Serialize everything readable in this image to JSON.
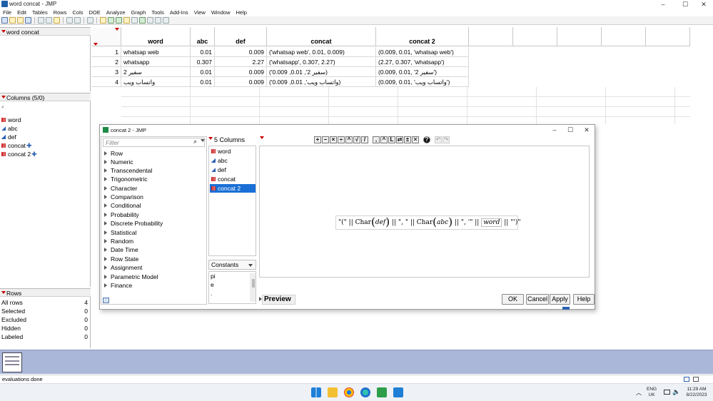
{
  "window": {
    "title": "word concat - JMP",
    "min": "–",
    "max": "☐",
    "close": "✕"
  },
  "menu": [
    "File",
    "Edit",
    "Tables",
    "Rows",
    "Cols",
    "DOE",
    "Analyze",
    "Graph",
    "Tools",
    "Add-Ins",
    "View",
    "Window",
    "Help"
  ],
  "table_panel": {
    "title": "word concat"
  },
  "columns_panel": {
    "title": "Columns (5/0)",
    "items": [
      {
        "label": "word",
        "type": "nominal",
        "formula": false
      },
      {
        "label": "abc",
        "type": "continuous",
        "formula": false
      },
      {
        "label": "def",
        "type": "continuous",
        "formula": false
      },
      {
        "label": "concat",
        "type": "nominal",
        "formula": true
      },
      {
        "label": "concat 2",
        "type": "nominal",
        "formula": true
      }
    ],
    "formula_mark": "✚"
  },
  "rows_panel": {
    "title": "Rows",
    "stats": [
      {
        "label": "All rows",
        "value": "4"
      },
      {
        "label": "Selected",
        "value": "0"
      },
      {
        "label": "Excluded",
        "value": "0"
      },
      {
        "label": "Hidden",
        "value": "0"
      },
      {
        "label": "Labeled",
        "value": "0"
      }
    ]
  },
  "grid": {
    "headers": [
      "word",
      "abc",
      "def",
      "concat",
      "concat 2"
    ],
    "rows": [
      {
        "n": "1",
        "word": "whatsap web",
        "abc": "0.01",
        "def": "0.009",
        "concat": "('whatsap web', 0.01, 0.009)",
        "concat2": "(0.009, 0.01, 'whatsap web')"
      },
      {
        "n": "2",
        "word": "whatsapp",
        "abc": "0.307",
        "def": "2.27",
        "concat": "('whatsapp', 0.307, 2.27)",
        "concat2": "(2.27, 0.307, 'whatsapp')"
      },
      {
        "n": "3",
        "word": "سفير 2",
        "abc": "0.01",
        "def": "0.009",
        "concat": "('0.009 ,0.01 ,'2 سفير)",
        "concat2": "(0.009, 0.01, '2 سفير')"
      },
      {
        "n": "4",
        "word": "واتساب ويب",
        "abc": "0.01",
        "def": "0.009",
        "concat": "('0.009 ,0.01 ,'واتساب ويب)",
        "concat2": "(0.009, 0.01, 'واتساب ويب')"
      }
    ]
  },
  "dialog": {
    "title": "concat 2 - JMP",
    "filter_placeholder": "Filter",
    "functions": [
      "Row",
      "Numeric",
      "Transcendental",
      "Trigonometric",
      "Character",
      "Comparison",
      "Conditional",
      "Probability",
      "Discrete Probability",
      "Statistical",
      "Random",
      "Date Time",
      "Row State",
      "Assignment",
      "Parametric Model",
      "Finance"
    ],
    "columns_header": "5 Columns",
    "columns": [
      "word",
      "abc",
      "def",
      "concat",
      "concat 2"
    ],
    "selected_column": "concat 2",
    "constants_label": "Constants",
    "constants": [
      "pi",
      "e",
      "."
    ],
    "formula": {
      "open": "\"(\"",
      "char1": "Char",
      "arg1": "def",
      "sep1": "\", \"",
      "char2": "Char",
      "arg2": "abc",
      "sep2": "\", '\"",
      "arg3": "word",
      "close": "\"')\"",
      "concat_op": "||"
    },
    "preview": "Preview",
    "buttons": {
      "ok": "OK",
      "cancel": "Cancel",
      "apply": "Apply",
      "help": "Help"
    }
  },
  "status": {
    "text": "evaluations done"
  },
  "tray": {
    "lang1": "ENG",
    "lang2": "UK",
    "time": "11:29 AM",
    "date": "8/22/2023"
  }
}
